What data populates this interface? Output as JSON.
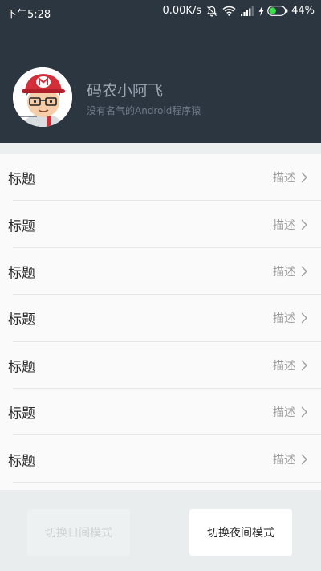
{
  "status_bar": {
    "time": "下午5:28",
    "speed": "0.00K/s",
    "battery": "44%",
    "icons": [
      "mute-bell-icon",
      "wifi-icon",
      "signal-icon",
      "charging-icon",
      "battery-icon"
    ]
  },
  "profile": {
    "name": "码农小阿飞",
    "bio": "没有名气的Android程序猿"
  },
  "list": {
    "items": [
      {
        "title": "标题",
        "desc": "描述"
      },
      {
        "title": "标题",
        "desc": "描述"
      },
      {
        "title": "标题",
        "desc": "描述"
      },
      {
        "title": "标题",
        "desc": "描述"
      },
      {
        "title": "标题",
        "desc": "描述"
      },
      {
        "title": "标题",
        "desc": "描述"
      },
      {
        "title": "标题",
        "desc": "描述"
      }
    ]
  },
  "buttons": {
    "day_mode": "切换日间模式",
    "night_mode": "切换夜间模式"
  },
  "colors": {
    "header_bg": "#2c3641",
    "list_bg": "#fafafa",
    "page_bg": "#e9eded"
  }
}
